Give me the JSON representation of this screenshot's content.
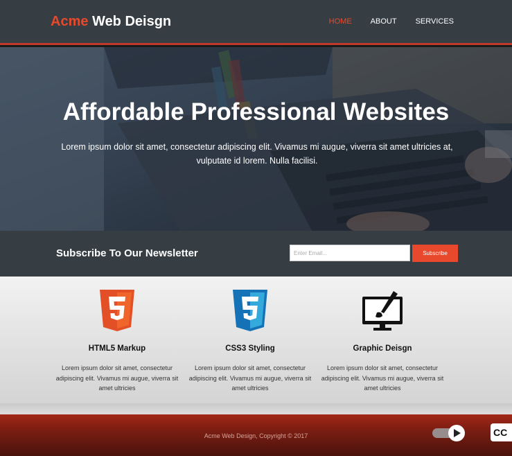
{
  "header": {
    "brand_highlight": "Acme",
    "brand_rest": "Web Deisgn",
    "nav": [
      {
        "label": "HOME",
        "active": true
      },
      {
        "label": "ABOUT",
        "active": false
      },
      {
        "label": "SERVICES",
        "active": false
      }
    ],
    "accent_color": "#e8492c"
  },
  "hero": {
    "title": "Affordable Professional Websites",
    "text": "Lorem ipsum dolor sit amet, consectetur adipiscing elit. Vivamus mi augue, viverra sit amet ultricies at, vulputate id lorem. Nulla facilisi."
  },
  "newsletter": {
    "title": "Subscribe To Our Newsletter",
    "email_placeholder": "Enter Email...",
    "button_label": "Subscribe"
  },
  "boxes": [
    {
      "icon": "html5-icon",
      "title": "HTML5 Markup",
      "text": "Lorem ipsum dolor sit amet, consectetur adipiscing elit. Vivamus mi augue, viverra sit amet ultricies"
    },
    {
      "icon": "css3-icon",
      "title": "CSS3 Styling",
      "text": "Lorem ipsum dolor sit amet, consectetur adipiscing elit. Vivamus mi augue, viverra sit amet ultricies"
    },
    {
      "icon": "monitor-brush-icon",
      "title": "Graphic Deisgn",
      "text": "Lorem ipsum dolor sit amet, consectetur adipiscing elit. Vivamus mi augue, viverra sit amet ultricies"
    }
  ],
  "footer": {
    "copyright": "Acme Web Design, Copyright © 2017"
  },
  "player": {
    "cc_label": "CC",
    "toggle_icon": "play-icon",
    "cc_icon": "closed-captions-icon"
  }
}
